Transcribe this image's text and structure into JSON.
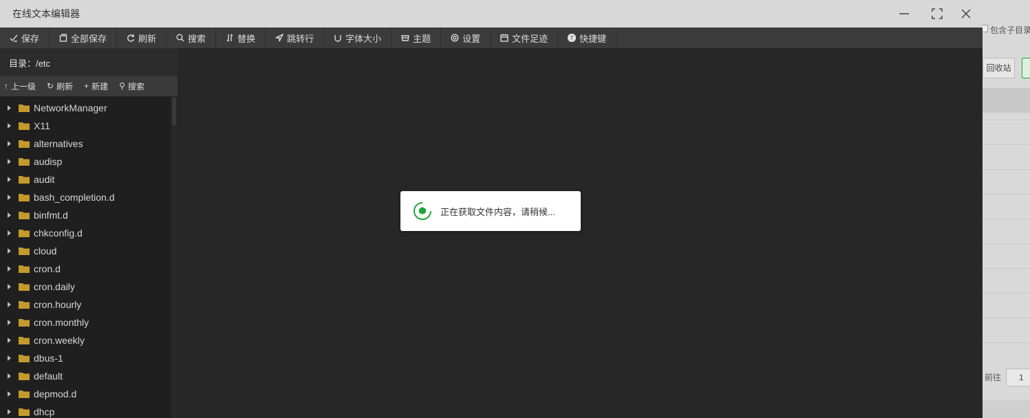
{
  "window": {
    "title": "在线文本编辑器"
  },
  "toolbar": [
    {
      "label": "保存",
      "icon": "save-icon"
    },
    {
      "label": "全部保存",
      "icon": "save-all-icon"
    },
    {
      "label": "刷新",
      "icon": "refresh-icon"
    },
    {
      "label": "搜索",
      "icon": "search-icon"
    },
    {
      "label": "替换",
      "icon": "replace-icon"
    },
    {
      "label": "跳转行",
      "icon": "jump-icon"
    },
    {
      "label": "字体大小",
      "icon": "font-size-icon"
    },
    {
      "label": "主题",
      "icon": "theme-icon"
    },
    {
      "label": "设置",
      "icon": "gear-icon"
    },
    {
      "label": "文件足迹",
      "icon": "calendar-icon"
    },
    {
      "label": "快捷键",
      "icon": "help-icon"
    }
  ],
  "sidebar": {
    "dir_label": "目录：/etc",
    "buttons": [
      {
        "label": "上一级",
        "glyph": "↑",
        "icon": "up-arrow-icon"
      },
      {
        "label": "刷新",
        "glyph": "↻",
        "icon": "refresh-icon"
      },
      {
        "label": "新建",
        "glyph": "+",
        "icon": "plus-icon"
      },
      {
        "label": "搜索",
        "glyph": "⚲",
        "icon": "search-icon"
      }
    ],
    "tree": [
      "NetworkManager",
      "X11",
      "alternatives",
      "audisp",
      "audit",
      "bash_completion.d",
      "binfmt.d",
      "chkconfig.d",
      "cloud",
      "cron.d",
      "cron.daily",
      "cron.hourly",
      "cron.monthly",
      "cron.weekly",
      "dbus-1",
      "default",
      "depmod.d",
      "dhcp"
    ]
  },
  "loading": {
    "text": "正在获取文件内容，请稍候..."
  },
  "background": {
    "checkbox_label": "包含子目录",
    "recycle_label": "回收站",
    "goto_label": "前往",
    "page_value": "1"
  },
  "colors": {
    "folder": "#c49a2c",
    "accent_green": "#20a53a",
    "toolbar_bg": "#3b3b3b"
  }
}
